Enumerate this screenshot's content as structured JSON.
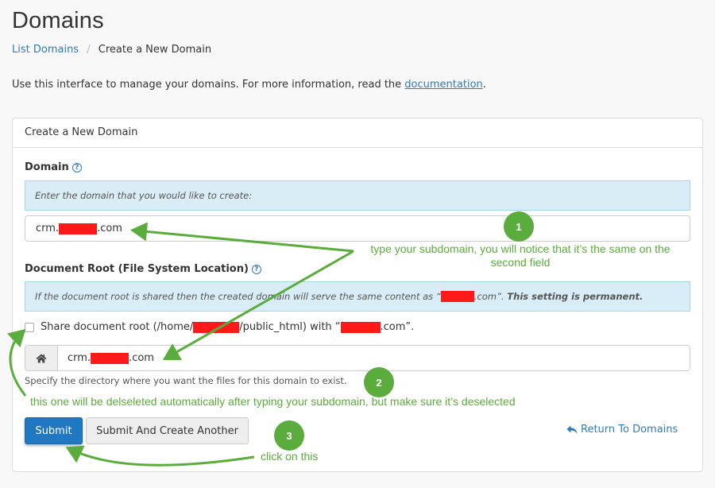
{
  "header": {
    "title": "Domains",
    "breadcrumb": {
      "link": "List Domains",
      "separator": "/",
      "current": "Create a New Domain"
    },
    "intro_text": "Use this interface to manage your domains. For more information, read the ",
    "intro_link": "documentation",
    "intro_end": "."
  },
  "panel": {
    "heading": "Create a New Domain",
    "domain": {
      "label": "Domain",
      "help_icon": "question-circle-icon",
      "callout": "Enter the domain that you would like to create:",
      "value_prefix": "crm.",
      "value_suffix": ".com",
      "redacted": true
    },
    "document_root": {
      "label": "Document Root (File System Location)",
      "help_icon": "question-circle-icon",
      "callout_prefix": "If the document root is shared then the created domain will serve the same content as “",
      "callout_suffix": ".com”. ",
      "callout_bold": "This setting is permanent.",
      "checkbox_prefix": "Share document root (/home/",
      "checkbox_middle": "/public_html) with “",
      "checkbox_suffix": ".com”.",
      "checkbox_checked": false,
      "addon_icon": "home-icon",
      "value_prefix": "crm.",
      "value_suffix": ".com",
      "help_text": "Specify the directory where you want the files for this domain to exist."
    },
    "buttons": {
      "submit": "Submit",
      "submit_another": "Submit And Create Another",
      "return_icon": "reply-arrow-icon",
      "return": "Return To Domains"
    }
  },
  "annotations": {
    "color": "#5aad3c",
    "redaction_color": "#ff1a1a",
    "steps": [
      {
        "number": "1",
        "note": "type your subdomain, you will notice that it’s the same on the second field"
      },
      {
        "number": "2",
        "note": "this one will be delseleted automatically after typing your subdomain, but make sure it’s deselected"
      },
      {
        "number": "3",
        "note": "click on this"
      }
    ]
  }
}
